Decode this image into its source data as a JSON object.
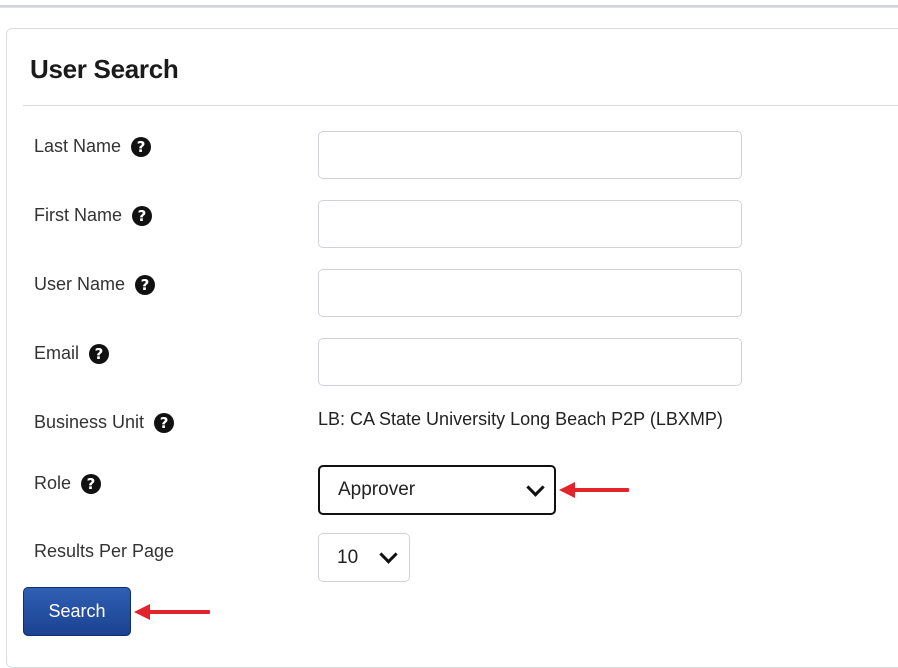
{
  "panel": {
    "title": "User Search"
  },
  "fields": {
    "last_name": {
      "label": "Last Name",
      "value": "",
      "placeholder": ""
    },
    "first_name": {
      "label": "First Name",
      "value": "",
      "placeholder": ""
    },
    "user_name": {
      "label": "User Name",
      "value": "",
      "placeholder": ""
    },
    "email": {
      "label": "Email",
      "value": "",
      "placeholder": ""
    },
    "business_unit": {
      "label": "Business Unit",
      "value": "LB: CA State University Long Beach P2P (LBXMP)"
    },
    "role": {
      "label": "Role",
      "selected": "Approver"
    },
    "results_per_page": {
      "label": "Results Per Page",
      "selected": "10"
    }
  },
  "help_icon_glyph": "?",
  "actions": {
    "search_label": "Search"
  },
  "colors": {
    "button_blue": "#1b4291",
    "annotation_red": "#e3242b",
    "help_icon": "#111111"
  },
  "icons": {
    "help": "question-circle-icon",
    "dropdown": "chevron-down-icon",
    "annotation": "red-arrow-icon"
  }
}
